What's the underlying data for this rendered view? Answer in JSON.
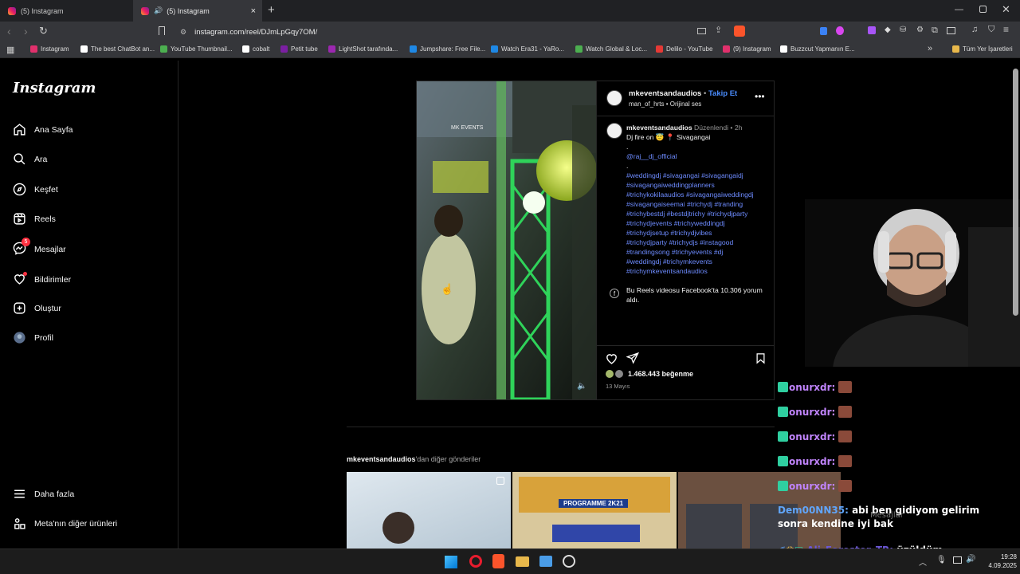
{
  "browser": {
    "tabs": [
      {
        "title": "(5) Instagram"
      },
      {
        "title": "(5) Instagram"
      }
    ],
    "url": "instagram.com/reel/DJmLpGqy7OM/",
    "bookmarks": [
      {
        "label": "Instagram",
        "color": "#e1306c"
      },
      {
        "label": "The best ChatBot an...",
        "color": "#ffffff"
      },
      {
        "label": "YouTube Thumbnail...",
        "color": "#4caf50"
      },
      {
        "label": "cobalt",
        "color": "#ffffff"
      },
      {
        "label": "Petit tube",
        "color": "#7b1fa2"
      },
      {
        "label": "LightShot tarafında...",
        "color": "#9c27b0"
      },
      {
        "label": "Jumpshare: Free File...",
        "color": "#1e88e5"
      },
      {
        "label": "Watch Era31 - YaRo...",
        "color": "#1e88e5"
      },
      {
        "label": "Watch Global & Loc...",
        "color": "#4caf50"
      },
      {
        "label": "Delilo - YouTube",
        "color": "#e53935"
      },
      {
        "label": "(9) Instagram",
        "color": "#e1306c"
      },
      {
        "label": "Buzzcut Yapmanın E...",
        "color": "#ffffff"
      }
    ],
    "all_bookmarks": "Tüm Yer İşaretleri"
  },
  "sidebar": {
    "logo": "Instagram",
    "items": [
      {
        "label": "Ana Sayfa",
        "icon": "home-icon"
      },
      {
        "label": "Ara",
        "icon": "search-icon"
      },
      {
        "label": "Keşfet",
        "icon": "compass-icon"
      },
      {
        "label": "Reels",
        "icon": "reels-icon"
      },
      {
        "label": "Mesajlar",
        "icon": "messenger-icon",
        "badge": "5"
      },
      {
        "label": "Bildirimler",
        "icon": "heart-icon"
      },
      {
        "label": "Oluştur",
        "icon": "plus-icon"
      },
      {
        "label": "Profil",
        "icon": "avatar-icon"
      }
    ],
    "more": "Daha fazla",
    "meta": "Meta'nın diğer ürünleri"
  },
  "post": {
    "username": "mkeventsandaudios",
    "follow": "Takip Et",
    "audio_user": "man_of_hrts",
    "audio_label": "Orijinal ses",
    "edited": "Düzenlendi",
    "time": "2h",
    "caption_line1": "Dj fire on",
    "caption_place": "Sivagangai",
    "dot": ".",
    "mention": "@raj__dj_official",
    "hashtags": [
      "#weddingdj #sivagangai #sivagangaidj",
      "#sivagangaiweddingplanners",
      "#trichykokilaaudios #sivagangaiweddingdj",
      "#sivagangaiseemai #trichydj #tranding",
      "#trichybestdj #bestdjtrichy #trichydjparty",
      "#trichydjevents #trichyweddingdj",
      "#trichydjsetup #trichydjvibes",
      "#trichydjparty #trichydjs #instagood",
      "#trandingsong #trichyevents #dj",
      "#weddingdj #trichymkevents",
      "#trichymkeventsandaudios"
    ],
    "fb_note": "Bu Reels videosu Facebook'ta 10.306 yorum aldı.",
    "likes": "1.468.443 beğenme",
    "date": "13 Mayıs",
    "video_overlay": "MK EVENTS"
  },
  "more_posts": {
    "username": "mkeventsandaudios",
    "suffix": "'dan diğer gönderiler",
    "thumb2_text": "PROGRAMME 2K21"
  },
  "chat": {
    "lines": [
      {
        "user": "onurxdr:",
        "msg": "",
        "color": "#c084fc"
      },
      {
        "user": "onurxdr:",
        "msg": "",
        "color": "#c084fc"
      },
      {
        "user": "onurxdr:",
        "msg": "",
        "color": "#c084fc"
      },
      {
        "user": "onurxdr:",
        "msg": "",
        "color": "#c084fc"
      },
      {
        "user": "onurxdr:",
        "msg": "",
        "color": "#c084fc"
      }
    ],
    "dem_user": "Dem00NN35:",
    "dem_msg": "abi ben gidiyom gelirim sonra kendine iyi bak",
    "ali_user": "Ali_Forester_TR:",
    "ali_msg": "üzüldüm",
    "messages_overlay": "Mesajlar"
  },
  "taskbar": {
    "time": "19:28",
    "date": "4.09.2025"
  }
}
